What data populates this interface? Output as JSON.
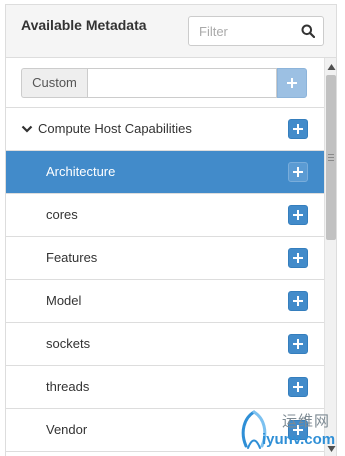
{
  "header": {
    "title": "Available Metadata",
    "filter_placeholder": "Filter",
    "filter_value": "",
    "search_icon": "search-icon"
  },
  "custom": {
    "addon_label": "Custom",
    "input_value": "",
    "add_icon": "plus-icon"
  },
  "tree": {
    "group": {
      "label": "Compute Host Capabilities",
      "expanded": true,
      "icon": "chevron-down-icon"
    },
    "items": [
      {
        "label": "Architecture",
        "selected": true
      },
      {
        "label": "cores",
        "selected": false
      },
      {
        "label": "Features",
        "selected": false
      },
      {
        "label": "Model",
        "selected": false
      },
      {
        "label": "sockets",
        "selected": false
      },
      {
        "label": "threads",
        "selected": false
      },
      {
        "label": "Vendor",
        "selected": false
      }
    ]
  },
  "watermark": {
    "cn_text": "运维网",
    "en_text": "iyunv.com"
  },
  "colors": {
    "accent": "#428bca",
    "selected_row": "#428bca",
    "heading_bg": "#f5f5f5",
    "border": "#dddddd"
  }
}
